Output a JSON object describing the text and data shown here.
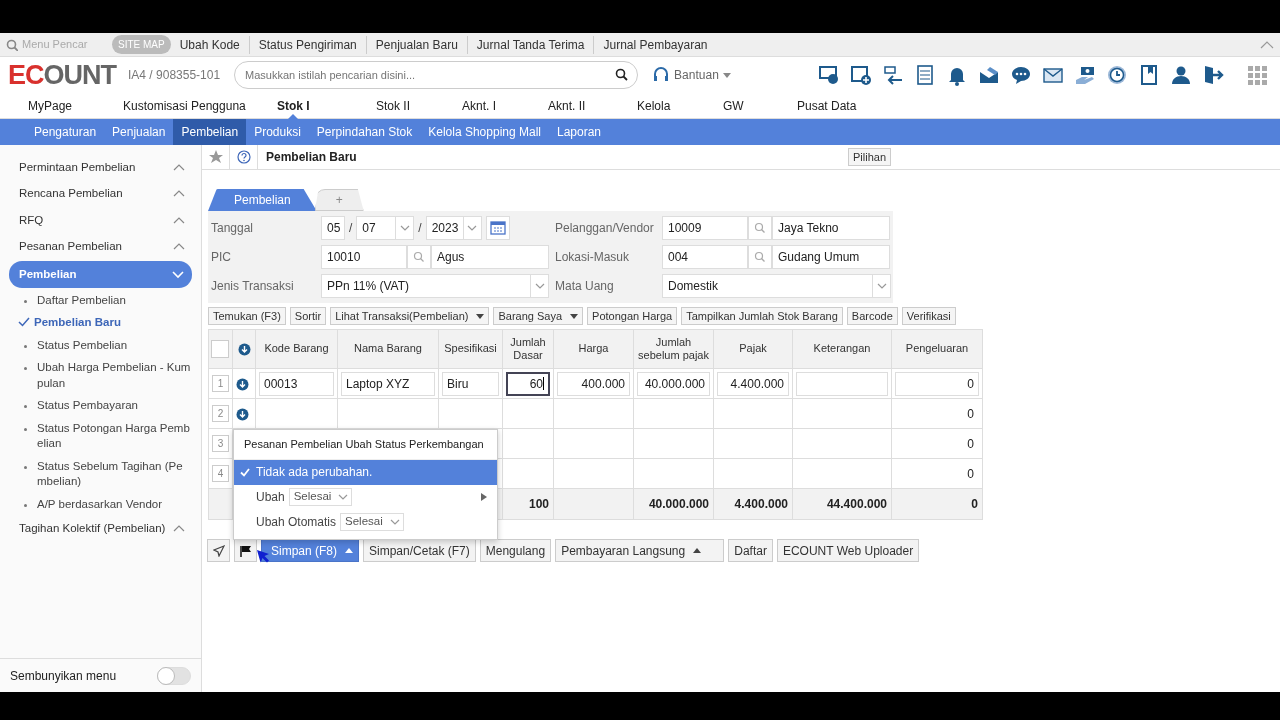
{
  "quick_bar": {
    "search_placeholder": "Menu Pencar",
    "site_map": "SITE MAP",
    "links": [
      "Ubah Kode",
      "Status Pengiriman",
      "Penjualan Baru",
      "Jurnal Tanda Terima",
      "Jurnal Pembayaran"
    ]
  },
  "header": {
    "logo": "ECOUNT",
    "account": "IA4 / 908355-101",
    "search": {
      "placeholder": "Masukkan istilah pencarian disini..."
    },
    "help": "Bantuan"
  },
  "main_menu": [
    {
      "label": "MyPage",
      "selected": false
    },
    {
      "label": "Kustomisasi Pengguna",
      "selected": false
    },
    {
      "label": "Stok I",
      "selected": true
    },
    {
      "label": "Stok II",
      "selected": false
    },
    {
      "label": "Aknt. I",
      "selected": false
    },
    {
      "label": "Aknt. II",
      "selected": false
    },
    {
      "label": "Kelola",
      "selected": false
    },
    {
      "label": "GW",
      "selected": false
    },
    {
      "label": "Pusat Data",
      "selected": false
    }
  ],
  "sub_menu": [
    {
      "label": "Pengaturan",
      "selected": false
    },
    {
      "label": "Penjualan",
      "selected": false
    },
    {
      "label": "Pembelian",
      "selected": true
    },
    {
      "label": "Produksi",
      "selected": false
    },
    {
      "label": "Perpindahan Stok",
      "selected": false
    },
    {
      "label": "Kelola Shopping Mall",
      "selected": false
    },
    {
      "label": "Laporan",
      "selected": false
    }
  ],
  "sidebar": {
    "items": [
      {
        "label": "Permintaan Pembelian",
        "selected": false,
        "expanded": false
      },
      {
        "label": "Rencana Pembelian",
        "selected": false,
        "expanded": false
      },
      {
        "label": "RFQ",
        "selected": false,
        "expanded": false
      },
      {
        "label": "Pesanan Pembelian",
        "selected": false,
        "expanded": false
      },
      {
        "label": "Pembelian",
        "selected": true,
        "expanded": true,
        "children": [
          {
            "label": "Daftar Pembelian",
            "selected": false
          },
          {
            "label": "Pembelian Baru",
            "selected": true
          },
          {
            "label": "Status Pembelian",
            "selected": false
          },
          {
            "label": "Ubah Harga Pembelian - Kumpulan",
            "selected": false
          },
          {
            "label": "Status Pembayaran",
            "selected": false
          },
          {
            "label": "Status Potongan Harga Pembelian",
            "selected": false
          },
          {
            "label": "Status Sebelum Tagihan (Pembelian)",
            "selected": false
          },
          {
            "label": "A/P berdasarkan Vendor",
            "selected": false
          }
        ]
      },
      {
        "label": "Tagihan Kolektif (Pembelian)",
        "selected": false,
        "expanded": false
      }
    ],
    "hide_menu": {
      "label": "Sembunyikan menu",
      "on": false
    }
  },
  "page": {
    "title": "Pembelian Baru",
    "options_button": "Pilihan"
  },
  "tabs": [
    {
      "label": "Pembelian",
      "selected": true
    },
    {
      "label": "+",
      "selected": false
    }
  ],
  "form": {
    "fields": [
      {
        "kind": "date",
        "label": "Tanggal",
        "day": "05",
        "month": "07",
        "year": "2023",
        "separator": "/"
      },
      {
        "kind": "lookup",
        "label": "Pelanggan/Vendor",
        "code": "10009",
        "name": "Jaya Tekno"
      },
      {
        "kind": "lookup",
        "label": "PIC",
        "code": "10010",
        "name": "Agus"
      },
      {
        "kind": "lookup",
        "label": "Lokasi-Masuk",
        "code": "004",
        "name": "Gudang Umum"
      },
      {
        "kind": "select",
        "label": "Jenis Transaksi",
        "value": "PPn 11% (VAT)"
      },
      {
        "kind": "select",
        "label": "Mata Uang",
        "value": "Domestik"
      }
    ]
  },
  "toolbar": [
    {
      "label": "Temukan (F3)",
      "dropdown": false
    },
    {
      "label": "Sortir",
      "dropdown": false
    },
    {
      "label": "Lihat Transaksi(Pembelian)",
      "dropdown": true
    },
    {
      "label": "Barang Saya",
      "dropdown": true
    },
    {
      "label": "Potongan Harga",
      "dropdown": false
    },
    {
      "label": "Tampilkan Jumlah Stok Barang",
      "dropdown": false
    },
    {
      "label": "Barcode",
      "dropdown": false
    },
    {
      "label": "Verifikasi",
      "dropdown": false
    }
  ],
  "table": {
    "select_all": {
      "checked": false
    },
    "columns": [
      "Kode Barang",
      "Nama Barang",
      "Spesifikasi",
      "Jumlah Dasar",
      "Harga",
      "Jumlah sebelum pajak",
      "Pajak",
      "Keterangan",
      "Pengeluaran"
    ],
    "rows": [
      {
        "number": "1",
        "kind": "input",
        "cells": [
          "00013",
          "Laptop XYZ",
          "Biru",
          "60",
          "400.000",
          "40.000.000",
          "4.400.000",
          null,
          "0"
        ]
      },
      {
        "number": "2",
        "kind": "blank",
        "cells": [
          null,
          null,
          null,
          null,
          null,
          null,
          null,
          null,
          "0"
        ]
      },
      {
        "number": "3",
        "kind": "covered",
        "cells": [
          null,
          null,
          null,
          null,
          null,
          null,
          null,
          null,
          "0"
        ]
      },
      {
        "number": "4",
        "kind": "covered",
        "cells": [
          null,
          null,
          null,
          null,
          null,
          null,
          null,
          null,
          "0"
        ]
      }
    ],
    "totals": {
      "jumlah_dasar": "100",
      "jumlah_sebelum_pajak": "40.000.000",
      "pajak": "4.400.000",
      "keterangan": "44.400.000",
      "pengeluaran": "0"
    }
  },
  "status_popup": {
    "title": "Pesanan Pembelian Ubah Status Perkembangan",
    "options": [
      {
        "kind": "plain",
        "label": "Tidak ada perubahan.",
        "submenu": false,
        "selected": true
      },
      {
        "kind": "select",
        "label": "Ubah",
        "value": "Selesai",
        "submenu": true,
        "selected": false
      },
      {
        "kind": "select",
        "label": "Ubah Otomatis",
        "value": "Selesai",
        "submenu": false,
        "selected": false
      }
    ]
  },
  "actions": [
    {
      "label": "Simpan (F8)",
      "kind": "primary",
      "dropdown": true
    },
    {
      "label": "Simpan/Cetak (F7)",
      "kind": "plain",
      "dropdown": false
    },
    {
      "label": "Mengulang",
      "kind": "plain",
      "dropdown": false
    },
    {
      "label": "Pembayaran Langsung",
      "kind": "plain",
      "dropdown": true
    },
    {
      "label": "Daftar",
      "kind": "plain",
      "dropdown": false
    },
    {
      "label": "ECOUNT Web Uploader",
      "kind": "plain",
      "dropdown": false
    }
  ]
}
